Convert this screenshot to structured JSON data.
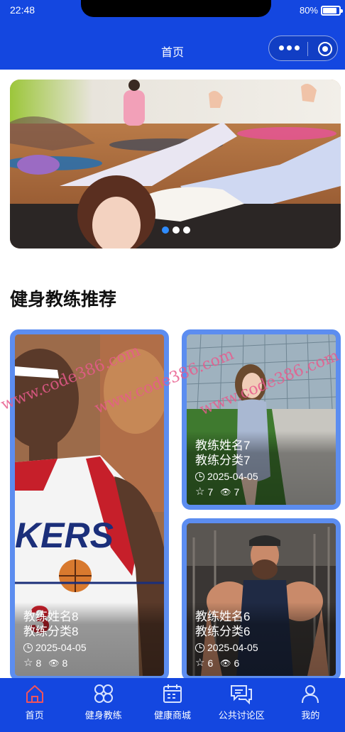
{
  "status_bar": {
    "time": "22:48",
    "battery": "80%"
  },
  "nav": {
    "title": "首页"
  },
  "banner": {
    "slides": 3,
    "active_index": 0
  },
  "section": {
    "title": "健身教练推荐"
  },
  "cards": [
    {
      "name": "教练姓名8",
      "category": "教练分类8",
      "date": "2025-04-05",
      "favorites": "8",
      "views": "8"
    },
    {
      "name": "教练姓名7",
      "category": "教练分类7",
      "date": "2025-04-05",
      "favorites": "7",
      "views": "7"
    },
    {
      "name": "教练姓名6",
      "category": "教练分类6",
      "date": "2025-04-05",
      "favorites": "6",
      "views": "6"
    }
  ],
  "watermark": "www.code386.com",
  "tabbar": {
    "items": [
      {
        "label": "首页",
        "icon": "home-icon",
        "active": true
      },
      {
        "label": "健身教练",
        "icon": "grid-icon",
        "active": false
      },
      {
        "label": "健康商城",
        "icon": "calendar-icon",
        "active": false
      },
      {
        "label": "公共讨论区",
        "icon": "chat-icon",
        "active": false
      },
      {
        "label": "我的",
        "icon": "user-icon",
        "active": false
      }
    ]
  },
  "colors": {
    "primary": "#1447e0",
    "card_border": "#5c8df0",
    "active_icon": "#f2545b",
    "watermark": "#e75a8c"
  }
}
